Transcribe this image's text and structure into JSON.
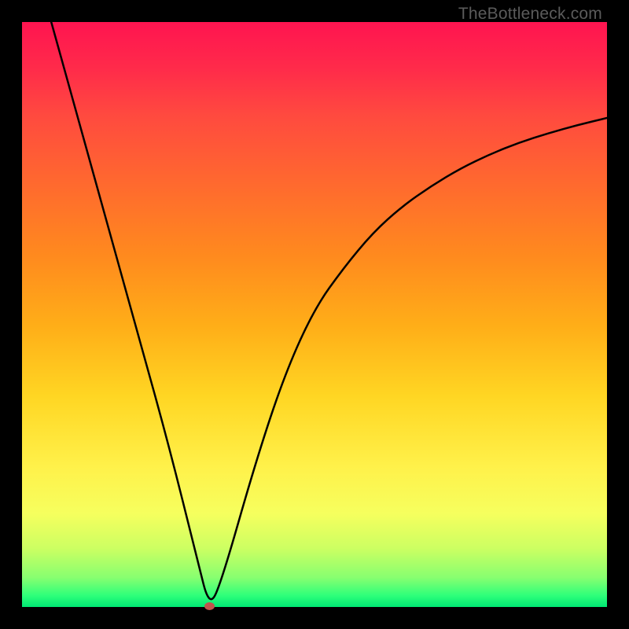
{
  "watermark": "TheBottleneck.com",
  "chart_data": {
    "type": "line",
    "title": "",
    "xlabel": "",
    "ylabel": "",
    "xlim": [
      0,
      100
    ],
    "ylim": [
      0,
      100
    ],
    "grid": false,
    "legend": false,
    "series": [
      {
        "name": "curve",
        "x": [
          5,
          10,
          15,
          20,
          25,
          30,
          32,
          34,
          40,
          45,
          50,
          55,
          60,
          65,
          70,
          75,
          80,
          85,
          90,
          95,
          100
        ],
        "y": [
          100,
          82,
          64,
          46,
          28,
          8,
          0,
          4,
          25,
          40,
          51,
          58,
          64,
          68.5,
          72,
          75,
          77.4,
          79.4,
          81,
          82.4,
          83.6
        ]
      }
    ],
    "marker": {
      "x": 32,
      "y": 0,
      "color": "#c1544d"
    },
    "background_gradient": [
      "#ff1450",
      "#ffd623",
      "#00e874"
    ],
    "curve_color": "#000000",
    "curve_width": 2.5
  }
}
